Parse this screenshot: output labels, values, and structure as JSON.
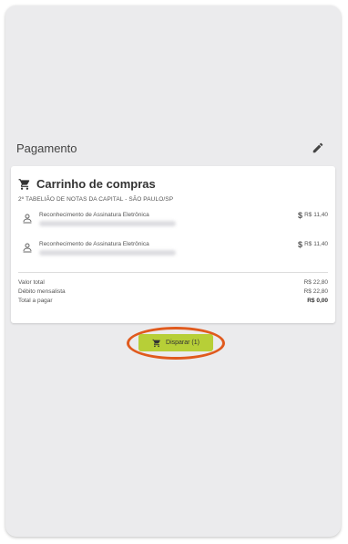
{
  "payment": {
    "title": "Pagamento"
  },
  "cart": {
    "title": "Carrinho de compras",
    "office": "2º TABELIÃO DE NOTAS DA CAPITAL - SÃO PAULO/SP",
    "items": [
      {
        "description": "Reconhecimento de Assinatura Eletrônica",
        "price": "R$ 11,40"
      },
      {
        "description": "Reconhecimento de Assinatura Eletrônica",
        "price": "R$ 11,40"
      }
    ],
    "money_symbol": "$"
  },
  "totals": [
    {
      "label": "Valor total",
      "value": "R$ 22,80"
    },
    {
      "label": "Débito mensalista",
      "value": "R$ 22,80"
    },
    {
      "label": "Total a pagar",
      "value": "R$ 0,00"
    }
  ],
  "dispatch": {
    "label": "Disparar (1)"
  },
  "colors": {
    "dispatch_button": "#b7cf37",
    "highlight_ring": "#e05a1e"
  }
}
